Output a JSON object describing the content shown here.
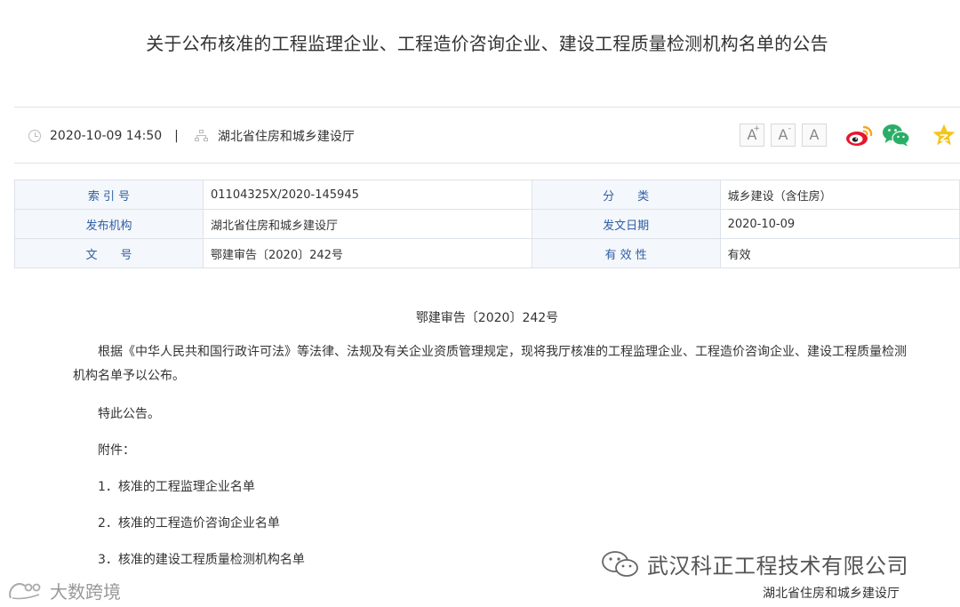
{
  "article": {
    "title": "关于公布核准的工程监理企业、工程造价咨询企业、建设工程质量检测机构名单的公告",
    "datetime": "2020-10-09 14:50",
    "separator": "|",
    "publisher": "湖北省住房和城乡建设厅"
  },
  "toolbar": {
    "font_increase": "A",
    "font_increase_mark": "+",
    "font_decrease": "A",
    "font_decrease_mark": "-",
    "font_default": "A",
    "icons": [
      "clock-icon",
      "org-icon",
      "weibo-icon",
      "wechat-icon",
      "favorite-star-icon"
    ],
    "colors": {
      "weibo": "#e6162d",
      "weibo_orange": "#f5a623",
      "wechat": "#2aae67",
      "star": "#f5c518"
    }
  },
  "info": {
    "rows": [
      {
        "k1": "索 引 号",
        "v1": "01104325X/2020-145945",
        "k2": "分　　类",
        "v2": "城乡建设（含住房）"
      },
      {
        "k1": "发布机构",
        "v1": "湖北省住房和城乡建设厅",
        "k2": "发文日期",
        "v2": "2020-10-09"
      },
      {
        "k1": "文　　号",
        "v1": "鄂建审告〔2020〕242号",
        "k2": "有 效 性",
        "v2": "有效"
      }
    ]
  },
  "body": {
    "doc_number": "鄂建审告〔2020〕242号",
    "paragraph1": "根据《中华人民共和国行政许可法》等法律、法规及有关企业资质管理规定，现将我厅核准的工程监理企业、工程造价咨询企业、建设工程质量检测机构名单予以公布。",
    "notice": "特此公告。",
    "attachments_label": "附件：",
    "attachments": [
      "1．核准的工程监理企业名单",
      "2．核准的工程造价咨询企业名单",
      "3．核准的建设工程质量检测机构名单"
    ]
  },
  "watermarks": {
    "wechat_account": "武汉科正工程技术有限公司",
    "signature": "湖北省住房和城乡建设厅",
    "bottom_left": "大数跨境"
  }
}
